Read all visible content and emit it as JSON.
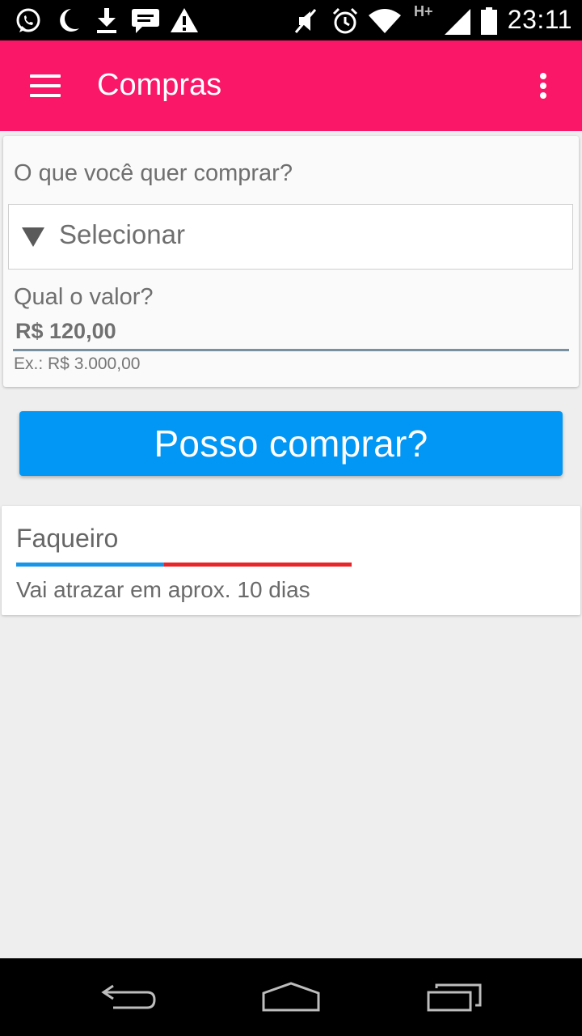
{
  "status_bar": {
    "time": "23:11",
    "network": "H+",
    "icons": [
      "whatsapp-icon",
      "moon-icon",
      "download-icon",
      "chat-icon",
      "warning-icon",
      "mute-icon",
      "alarm-icon",
      "wifi-icon",
      "signal-icon",
      "battery-icon"
    ]
  },
  "toolbar": {
    "title": "Compras",
    "color": "#fa1767"
  },
  "form": {
    "question_label": "O que você quer comprar?",
    "select_value": "Selecionar",
    "value_label": "Qual o valor?",
    "value_input": "R$ 120,00",
    "value_hint": "Ex.: R$ 3.000,00"
  },
  "action": {
    "label": "Posso comprar?",
    "color": "#0397f5"
  },
  "result": {
    "title": "Faqueiro",
    "progress_fraction": 0.44,
    "progress_colors": {
      "fill": "#1796e8",
      "remainder": "#e6262a"
    },
    "status": "Vai atrazar em aprox. 10 dias"
  },
  "nav_bar": {
    "icons": [
      "back-icon",
      "home-icon",
      "recents-icon"
    ]
  }
}
